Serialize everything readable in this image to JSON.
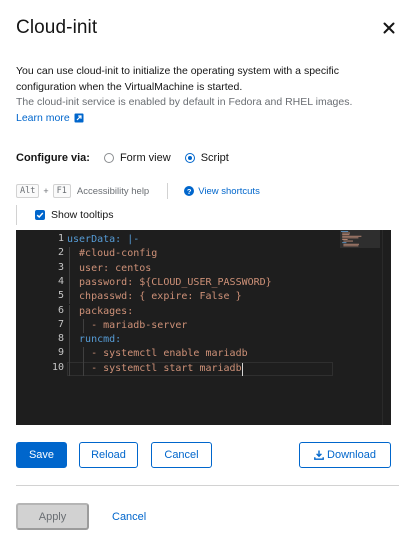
{
  "modal": {
    "title": "Cloud-init",
    "description_line1": "You can use cloud-init to initialize the operating system with a specific",
    "description_line2": "configuration when the VirtualMachine is started.",
    "description_line3": "The cloud-init service is enabled by default in Fedora and RHEL images.",
    "learn_more": "Learn more"
  },
  "configure": {
    "label": "Configure via:",
    "options": [
      {
        "label": "Form view",
        "selected": false
      },
      {
        "label": "Script",
        "selected": true
      }
    ]
  },
  "editor_toolbar": {
    "key1": "Alt",
    "plus": "+",
    "key2": "F1",
    "accessibility_help": "Accessibility help",
    "view_shortcuts": "View shortcuts",
    "show_tooltips": "Show tooltips",
    "show_tooltips_checked": true
  },
  "editor": {
    "line_numbers": [
      "1",
      "2",
      "3",
      "4",
      "5",
      "6",
      "7",
      "8",
      "9",
      "10"
    ],
    "lines": [
      {
        "text": "userData: |-",
        "kind": "key"
      },
      {
        "text": "  #cloud-config",
        "kind": "str"
      },
      {
        "text": "  user: centos",
        "kind": "str"
      },
      {
        "text": "  password: ${CLOUD_USER_PASSWORD}",
        "kind": "str"
      },
      {
        "text": "  chpasswd: { expire: False }",
        "kind": "str"
      },
      {
        "text": "  packages:",
        "kind": "str"
      },
      {
        "text": "    - mariadb-server",
        "kind": "str"
      },
      {
        "text": "  runcmd:",
        "kind": "key"
      },
      {
        "text": "    - systemctl enable mariadb",
        "kind": "str"
      },
      {
        "text": "    - systemctl start mariadb",
        "kind": "str"
      }
    ],
    "colors": {
      "background": "#1e1e1e",
      "string": "#ce9178",
      "keyword": "#569cd6",
      "line_number": "#c6c6c6"
    }
  },
  "actions": {
    "save": "Save",
    "reload": "Reload",
    "cancel": "Cancel",
    "download": "Download"
  },
  "footer": {
    "apply": "Apply",
    "cancel": "Cancel"
  },
  "colors": {
    "accent": "#0066cc",
    "text": "#151515",
    "muted": "#6a6e73"
  }
}
